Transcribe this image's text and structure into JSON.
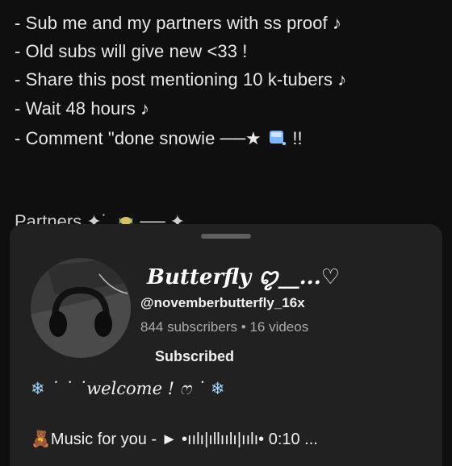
{
  "post": {
    "lines": [
      "- Sub me and my partners with ss proof ♪",
      "- Old subs will give new <33 !",
      "- Share this post mentioning 10 k-tubers ♪",
      "- Wait 48 hours ♪",
      "- Comment  \"done snowie ──★",
      "!!"
    ],
    "partners_label": "Partners ✦˙.",
    "partners_tail": "── ✦"
  },
  "sheet": {
    "channel_name": "Butterfly ꨄ︎__...♡",
    "handle": "@novemberbutterfly_16x",
    "subscribers": "844 subscribers",
    "separator": "•",
    "videos": "16 videos",
    "subscribed_label": "Subscribed",
    "welcome_text": "˙ ˙ ˙welcome ! ෆ ˙",
    "music_text": "Music for you  - ► •ıılı|ıllıılı|ıılı• 0:10 ..."
  },
  "icons": {
    "snowflake": "❄",
    "teddy": "🧸"
  }
}
